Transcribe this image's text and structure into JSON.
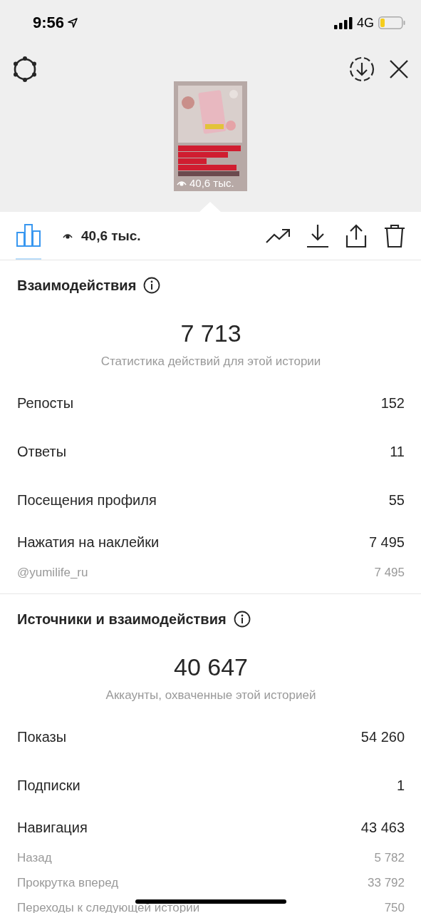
{
  "status_bar": {
    "time": "9:56",
    "network": "4G"
  },
  "story_preview": {
    "views": "40,6 тыс."
  },
  "toolbar": {
    "insights_tab": {
      "selected": true
    },
    "views": "40,6 тыс."
  },
  "sections": [
    {
      "title": "Взаимодействия",
      "total": "7 713",
      "caption": "Статистика действий для этой истории",
      "rows": [
        {
          "label": "Репосты",
          "value": "152"
        },
        {
          "label": "Ответы",
          "value": "11"
        },
        {
          "label": "Посещения профиля",
          "value": "55"
        },
        {
          "label": "Нажатия на наклейки",
          "value": "7 495",
          "children": [
            {
              "label": "@yumilife_ru",
              "value": "7 495"
            }
          ]
        }
      ]
    },
    {
      "title": "Источники и взаимодействия",
      "total": "40 647",
      "caption": "Аккаунты, охваченные этой историей",
      "rows": [
        {
          "label": "Показы",
          "value": "54 260"
        },
        {
          "label": "Подписки",
          "value": "1"
        },
        {
          "label": "Навигация",
          "value": "43 463",
          "children": [
            {
              "label": "Назад",
              "value": "5 782"
            },
            {
              "label": "Прокрутка вперед",
              "value": "33 792"
            },
            {
              "label": "Переходы к следующей истории",
              "value": "750"
            }
          ]
        }
      ]
    }
  ]
}
